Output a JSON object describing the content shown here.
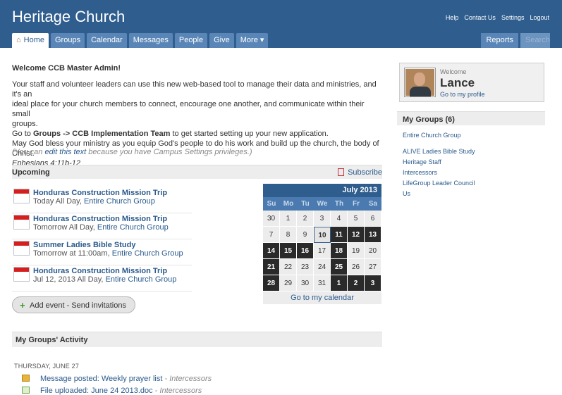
{
  "header": {
    "title": "Heritage Church",
    "top_links": [
      "Help",
      "Contact Us",
      "Settings",
      "Logout"
    ],
    "tabs": [
      "Home",
      "Groups",
      "Calendar",
      "Messages",
      "People",
      "Give",
      "More ▾"
    ],
    "right_tabs": [
      "Reports"
    ],
    "search_placeholder": "Search"
  },
  "welcome": {
    "heading": "Welcome CCB Master Admin!",
    "line1": "Your staff and volunteer leaders can use this new web-based tool to manage their data and ministries, and it's an",
    "line2": "ideal place for your church members to connect, encourage one another, and communicate within their small",
    "line3": "groups.",
    "line4_pre": "Go to ",
    "line4_bold": "Groups -> CCB Implementation Team",
    "line4_post": " to get started setting up your new application.",
    "line5": "May God bless your ministry as you equip God's people to do his work and build up the church, the body of Christ.",
    "verse": "Ephesians 4:11b-12",
    "note_pre": "(You can ",
    "note_link": "edit this text",
    "note_post": " because you have Campus Settings privileges.)"
  },
  "upcoming": {
    "heading": "Upcoming",
    "subscribe": "Subscribe",
    "events": [
      {
        "title": "Honduras Construction Mission Trip",
        "when": "Today All Day, ",
        "group": "Entire Church Group"
      },
      {
        "title": "Honduras Construction Mission Trip",
        "when": "Tomorrow All Day, ",
        "group": "Entire Church Group"
      },
      {
        "title": "Summer Ladies Bible Study",
        "when": "Tomorrow at 11:00am, ",
        "group": "Entire Church Group"
      },
      {
        "title": "Honduras Construction Mission Trip",
        "when": "Jul 12, 2013 All Day, ",
        "group": "Entire Church Group"
      }
    ],
    "add_event": "Add event - Send invitations"
  },
  "calendar": {
    "month": "July 2013",
    "dow": [
      "Su",
      "Mo",
      "Tu",
      "We",
      "Th",
      "Fr",
      "Sa"
    ],
    "days": [
      {
        "d": "30",
        "s": "past"
      },
      {
        "d": "1",
        "s": ""
      },
      {
        "d": "2",
        "s": ""
      },
      {
        "d": "3",
        "s": ""
      },
      {
        "d": "4",
        "s": ""
      },
      {
        "d": "5",
        "s": ""
      },
      {
        "d": "6",
        "s": ""
      },
      {
        "d": "7",
        "s": ""
      },
      {
        "d": "8",
        "s": ""
      },
      {
        "d": "9",
        "s": ""
      },
      {
        "d": "10",
        "s": "today"
      },
      {
        "d": "11",
        "s": "event"
      },
      {
        "d": "12",
        "s": "event"
      },
      {
        "d": "13",
        "s": "event"
      },
      {
        "d": "14",
        "s": "event"
      },
      {
        "d": "15",
        "s": "event"
      },
      {
        "d": "16",
        "s": "event"
      },
      {
        "d": "17",
        "s": ""
      },
      {
        "d": "18",
        "s": "event"
      },
      {
        "d": "19",
        "s": ""
      },
      {
        "d": "20",
        "s": ""
      },
      {
        "d": "21",
        "s": "event"
      },
      {
        "d": "22",
        "s": ""
      },
      {
        "d": "23",
        "s": ""
      },
      {
        "d": "24",
        "s": ""
      },
      {
        "d": "25",
        "s": "event"
      },
      {
        "d": "26",
        "s": ""
      },
      {
        "d": "27",
        "s": ""
      },
      {
        "d": "28",
        "s": "event"
      },
      {
        "d": "29",
        "s": ""
      },
      {
        "d": "30",
        "s": ""
      },
      {
        "d": "31",
        "s": ""
      },
      {
        "d": "1",
        "s": "event"
      },
      {
        "d": "2",
        "s": "event"
      },
      {
        "d": "3",
        "s": "event"
      }
    ],
    "footer": "Go to my calendar"
  },
  "activity": {
    "heading": "My Groups' Activity",
    "date": "THURSDAY, JUNE 27",
    "items": [
      {
        "text": "Message posted: Weekly prayer list",
        "group": " - Intercessors",
        "icon": "message-icon"
      },
      {
        "text": "File uploaded: June 24 2013.doc",
        "group": " - Intercessors",
        "icon": "file-icon"
      }
    ]
  },
  "profile": {
    "welcome": "Welcome",
    "name": "Lance",
    "link": "Go to my profile"
  },
  "my_groups": {
    "heading": "My Groups (6)",
    "groups": [
      "Entire Church Group",
      "ALIVE Ladies Bible Study",
      "Heritage Staff",
      "Intercessors",
      "LifeGroup Leader Council",
      "Us"
    ]
  },
  "colors": {
    "header": "#2e5d8e",
    "tab": "#5986b7",
    "event_day": "#2a2a2a",
    "link": "#2a5a8c"
  }
}
